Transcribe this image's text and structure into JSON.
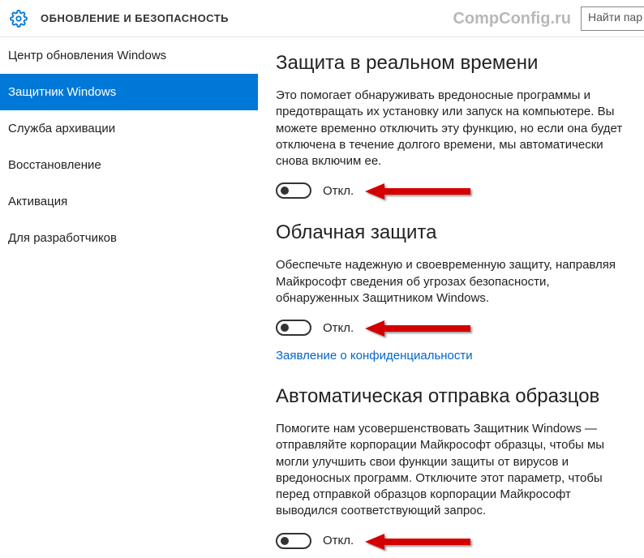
{
  "header": {
    "title": "ОБНОВЛЕНИЕ И БЕЗОПАСНОСТЬ",
    "watermark": "CompConfig.ru",
    "search_placeholder": "Найти пар"
  },
  "sidebar": {
    "items": [
      {
        "label": "Центр обновления Windows",
        "selected": false
      },
      {
        "label": "Защитник Windows",
        "selected": true
      },
      {
        "label": "Служба архивации",
        "selected": false
      },
      {
        "label": "Восстановление",
        "selected": false
      },
      {
        "label": "Активация",
        "selected": false
      },
      {
        "label": "Для разработчиков",
        "selected": false
      }
    ]
  },
  "sections": {
    "realtime": {
      "title": "Защита в реальном времени",
      "desc": "Это помогает обнаруживать вредоносные программы и предотвращать их установку или запуск на компьютере. Вы можете временно отключить эту функцию, но если она будет отключена в течение долгого времени, мы автоматически снова включим ее.",
      "toggle_state": "Откл."
    },
    "cloud": {
      "title": "Облачная защита",
      "desc": "Обеспечьте надежную и своевременную защиту, направляя Майкрософт сведения об угрозах безопасности, обнаруженных Защитником Windows.",
      "toggle_state": "Откл.",
      "privacy_link": "Заявление о конфиденциальности"
    },
    "samples": {
      "title": "Автоматическая отправка образцов",
      "desc": "Помогите нам усовершенствовать Защитник Windows — отправляйте корпорации Майкрософт образцы, чтобы мы могли улучшить свои функции защиты от вирусов и вредоносных программ. Отключите этот параметр, чтобы перед отправкой образцов корпорации Майкрософт выводился соответствующий запрос.",
      "toggle_state": "Откл."
    }
  }
}
